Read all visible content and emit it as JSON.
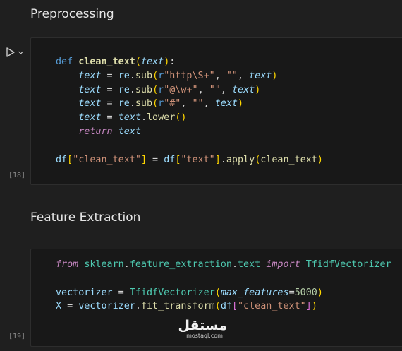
{
  "markdown": {
    "preprocessing_heading": "Preprocessing",
    "feature_heading": "Feature Extraction"
  },
  "cells": [
    {
      "execution_count": "[18]",
      "lines": [
        [
          [
            "def",
            "kw"
          ],
          [
            " ",
            ""
          ],
          [
            "clean_text",
            "fn"
          ],
          [
            "(",
            "p1"
          ],
          [
            "text",
            "param"
          ],
          [
            ")",
            "p1"
          ],
          [
            ":",
            "op"
          ]
        ],
        [
          [
            "    ",
            ""
          ],
          [
            "text",
            "param"
          ],
          [
            " = ",
            "op"
          ],
          [
            "re",
            "var"
          ],
          [
            ".",
            "op"
          ],
          [
            "sub",
            "call"
          ],
          [
            "(",
            "p1"
          ],
          [
            "r",
            "kw"
          ],
          [
            "\"http\\S+\"",
            "str"
          ],
          [
            ", ",
            "op"
          ],
          [
            "\"\"",
            "str"
          ],
          [
            ", ",
            "op"
          ],
          [
            "text",
            "param"
          ],
          [
            ")",
            "p1"
          ]
        ],
        [
          [
            "    ",
            ""
          ],
          [
            "text",
            "param"
          ],
          [
            " = ",
            "op"
          ],
          [
            "re",
            "var"
          ],
          [
            ".",
            "op"
          ],
          [
            "sub",
            "call"
          ],
          [
            "(",
            "p1"
          ],
          [
            "r",
            "kw"
          ],
          [
            "\"@\\w+\"",
            "str"
          ],
          [
            ", ",
            "op"
          ],
          [
            "\"\"",
            "str"
          ],
          [
            ", ",
            "op"
          ],
          [
            "text",
            "param"
          ],
          [
            ")",
            "p1"
          ]
        ],
        [
          [
            "    ",
            ""
          ],
          [
            "text",
            "param"
          ],
          [
            " = ",
            "op"
          ],
          [
            "re",
            "var"
          ],
          [
            ".",
            "op"
          ],
          [
            "sub",
            "call"
          ],
          [
            "(",
            "p1"
          ],
          [
            "r",
            "kw"
          ],
          [
            "\"#\"",
            "str"
          ],
          [
            ", ",
            "op"
          ],
          [
            "\"\"",
            "str"
          ],
          [
            ", ",
            "op"
          ],
          [
            "text",
            "param"
          ],
          [
            ")",
            "p1"
          ]
        ],
        [
          [
            "    ",
            ""
          ],
          [
            "text",
            "param"
          ],
          [
            " = ",
            "op"
          ],
          [
            "text",
            "param"
          ],
          [
            ".",
            "op"
          ],
          [
            "lower",
            "call"
          ],
          [
            "()",
            "p1"
          ]
        ],
        [
          [
            "    ",
            ""
          ],
          [
            "return",
            "ctl"
          ],
          [
            " ",
            ""
          ],
          [
            "text",
            "param"
          ]
        ],
        [],
        [
          [
            "df",
            "var"
          ],
          [
            "[",
            "p1"
          ],
          [
            "\"clean_text\"",
            "str"
          ],
          [
            "]",
            "p1"
          ],
          [
            " = ",
            "op"
          ],
          [
            "df",
            "var"
          ],
          [
            "[",
            "p1"
          ],
          [
            "\"text\"",
            "str"
          ],
          [
            "]",
            "p1"
          ],
          [
            ".",
            "op"
          ],
          [
            "apply",
            "call"
          ],
          [
            "(",
            "p1"
          ],
          [
            "clean_text",
            "call"
          ],
          [
            ")",
            "p1"
          ]
        ]
      ]
    },
    {
      "execution_count": "[19]",
      "lines": [
        [
          [
            "from",
            "ctl"
          ],
          [
            " ",
            ""
          ],
          [
            "sklearn",
            "cls"
          ],
          [
            ".",
            "op"
          ],
          [
            "feature_extraction",
            "cls"
          ],
          [
            ".",
            "op"
          ],
          [
            "text",
            "cls"
          ],
          [
            " ",
            ""
          ],
          [
            "import",
            "ctl"
          ],
          [
            " ",
            ""
          ],
          [
            "TfidfVectorizer",
            "cls"
          ]
        ],
        [],
        [
          [
            "vectorizer",
            "var"
          ],
          [
            " = ",
            "op"
          ],
          [
            "TfidfVectorizer",
            "cls"
          ],
          [
            "(",
            "p1"
          ],
          [
            "max_features",
            "param"
          ],
          [
            "=",
            "op"
          ],
          [
            "5000",
            "num"
          ],
          [
            ")",
            "p1"
          ]
        ],
        [
          [
            "X",
            "var"
          ],
          [
            " = ",
            "op"
          ],
          [
            "vectorizer",
            "var"
          ],
          [
            ".",
            "op"
          ],
          [
            "fit_transform",
            "call"
          ],
          [
            "(",
            "p1"
          ],
          [
            "df",
            "var"
          ],
          [
            "[",
            "p2"
          ],
          [
            "\"clean_text\"",
            "str"
          ],
          [
            "]",
            "p2"
          ],
          [
            ")",
            "p1"
          ]
        ]
      ]
    }
  ],
  "watermark": {
    "logo_text": "مستقل",
    "url": "mostaql.com"
  },
  "icons": {
    "run": "play-icon",
    "expand": "chevron-down-icon"
  }
}
